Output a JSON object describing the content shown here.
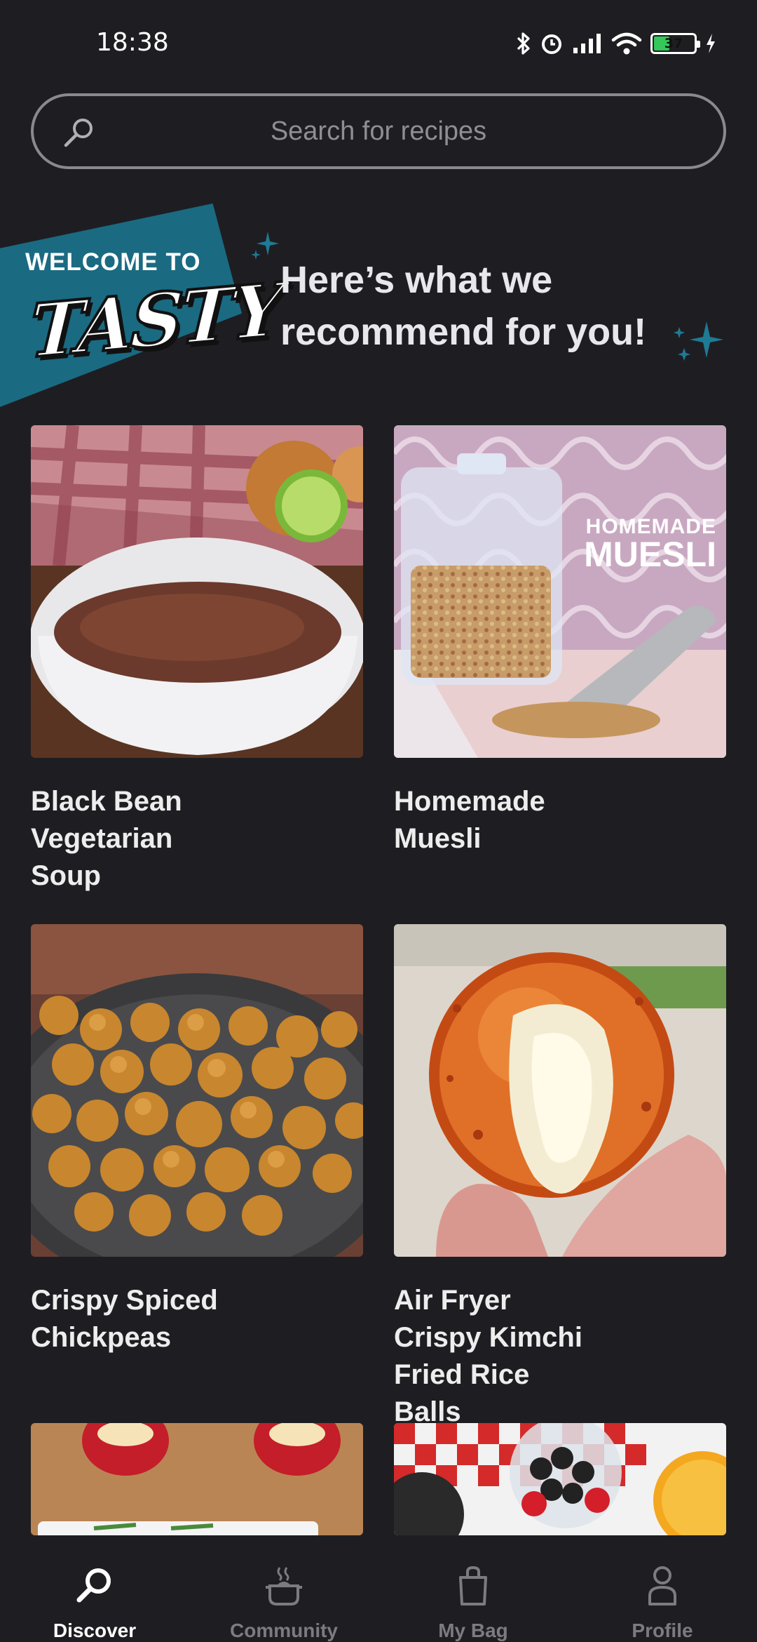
{
  "status_bar": {
    "time": "18:38",
    "battery_level": "37",
    "icons": [
      "bluetooth-icon",
      "alarm-icon",
      "signal-icon",
      "wifi-icon",
      "battery-icon",
      "charging-icon"
    ]
  },
  "search": {
    "placeholder": "Search for recipes"
  },
  "banner": {
    "welcome_to": "WELCOME TO",
    "brand": "TASTY",
    "heading": "Here’s what we recommend for you!"
  },
  "recipes": [
    {
      "title": "Black Bean Vegetarian Soup"
    },
    {
      "title": "Homemade Muesli",
      "image_text_line1": "HOMEMADE",
      "image_text_line2": "MUESLI"
    },
    {
      "title": "Crispy Spiced Chickpeas"
    },
    {
      "title": "Air Fryer Crispy Kimchi Fried Rice Balls"
    },
    {
      "title": ""
    },
    {
      "title": ""
    }
  ],
  "bottom_nav": {
    "items": [
      {
        "label": "Discover",
        "icon": "search-icon",
        "active": true
      },
      {
        "label": "Community",
        "icon": "pot-icon",
        "active": false
      },
      {
        "label": "My Bag",
        "icon": "bag-icon",
        "active": false
      },
      {
        "label": "Profile",
        "icon": "profile-icon",
        "active": false
      }
    ]
  },
  "colors": {
    "background": "#1e1e22",
    "accent_teal": "#1a6a82",
    "text_primary": "#ececec",
    "nav_inactive": "#7c7c80"
  }
}
